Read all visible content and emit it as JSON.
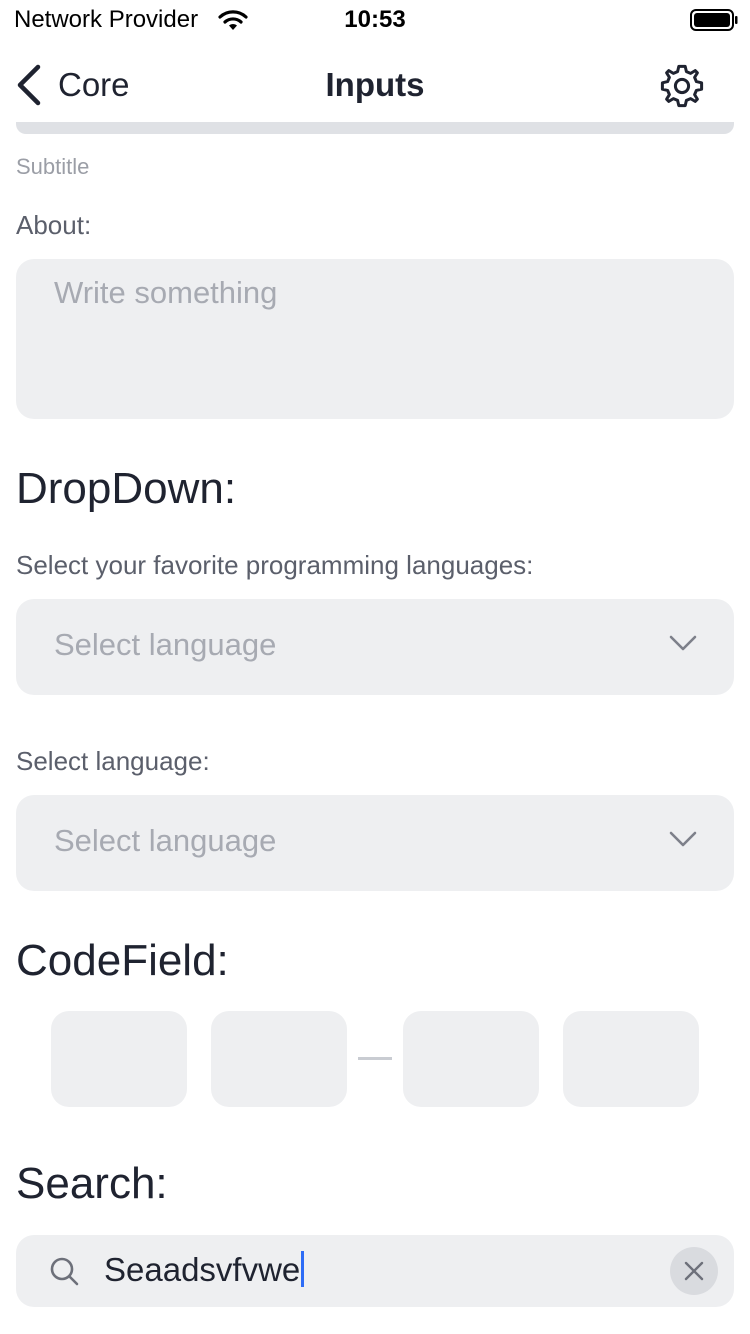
{
  "status_bar": {
    "carrier": "Network Provider",
    "time": "10:53"
  },
  "nav": {
    "back_label": "Core",
    "title": "Inputs",
    "settings_icon": "gear-icon"
  },
  "form": {
    "subtitle": "Subtitle",
    "about": {
      "label": "About:",
      "placeholder": "Write something",
      "value": ""
    }
  },
  "dropdown": {
    "heading": "DropDown:",
    "multi": {
      "label": "Select your favorite programming languages:",
      "placeholder": "Select language"
    },
    "single": {
      "label": "Select language:",
      "placeholder": "Select language"
    }
  },
  "codefield": {
    "heading": "CodeField:",
    "cells": [
      "",
      "",
      "",
      ""
    ]
  },
  "search": {
    "heading": "Search:",
    "value": "Seaadsvfvwe"
  },
  "colors": {
    "field_background": "#eeeff1",
    "caret": "#2d6cf6",
    "placeholder": "#a7aab2"
  }
}
